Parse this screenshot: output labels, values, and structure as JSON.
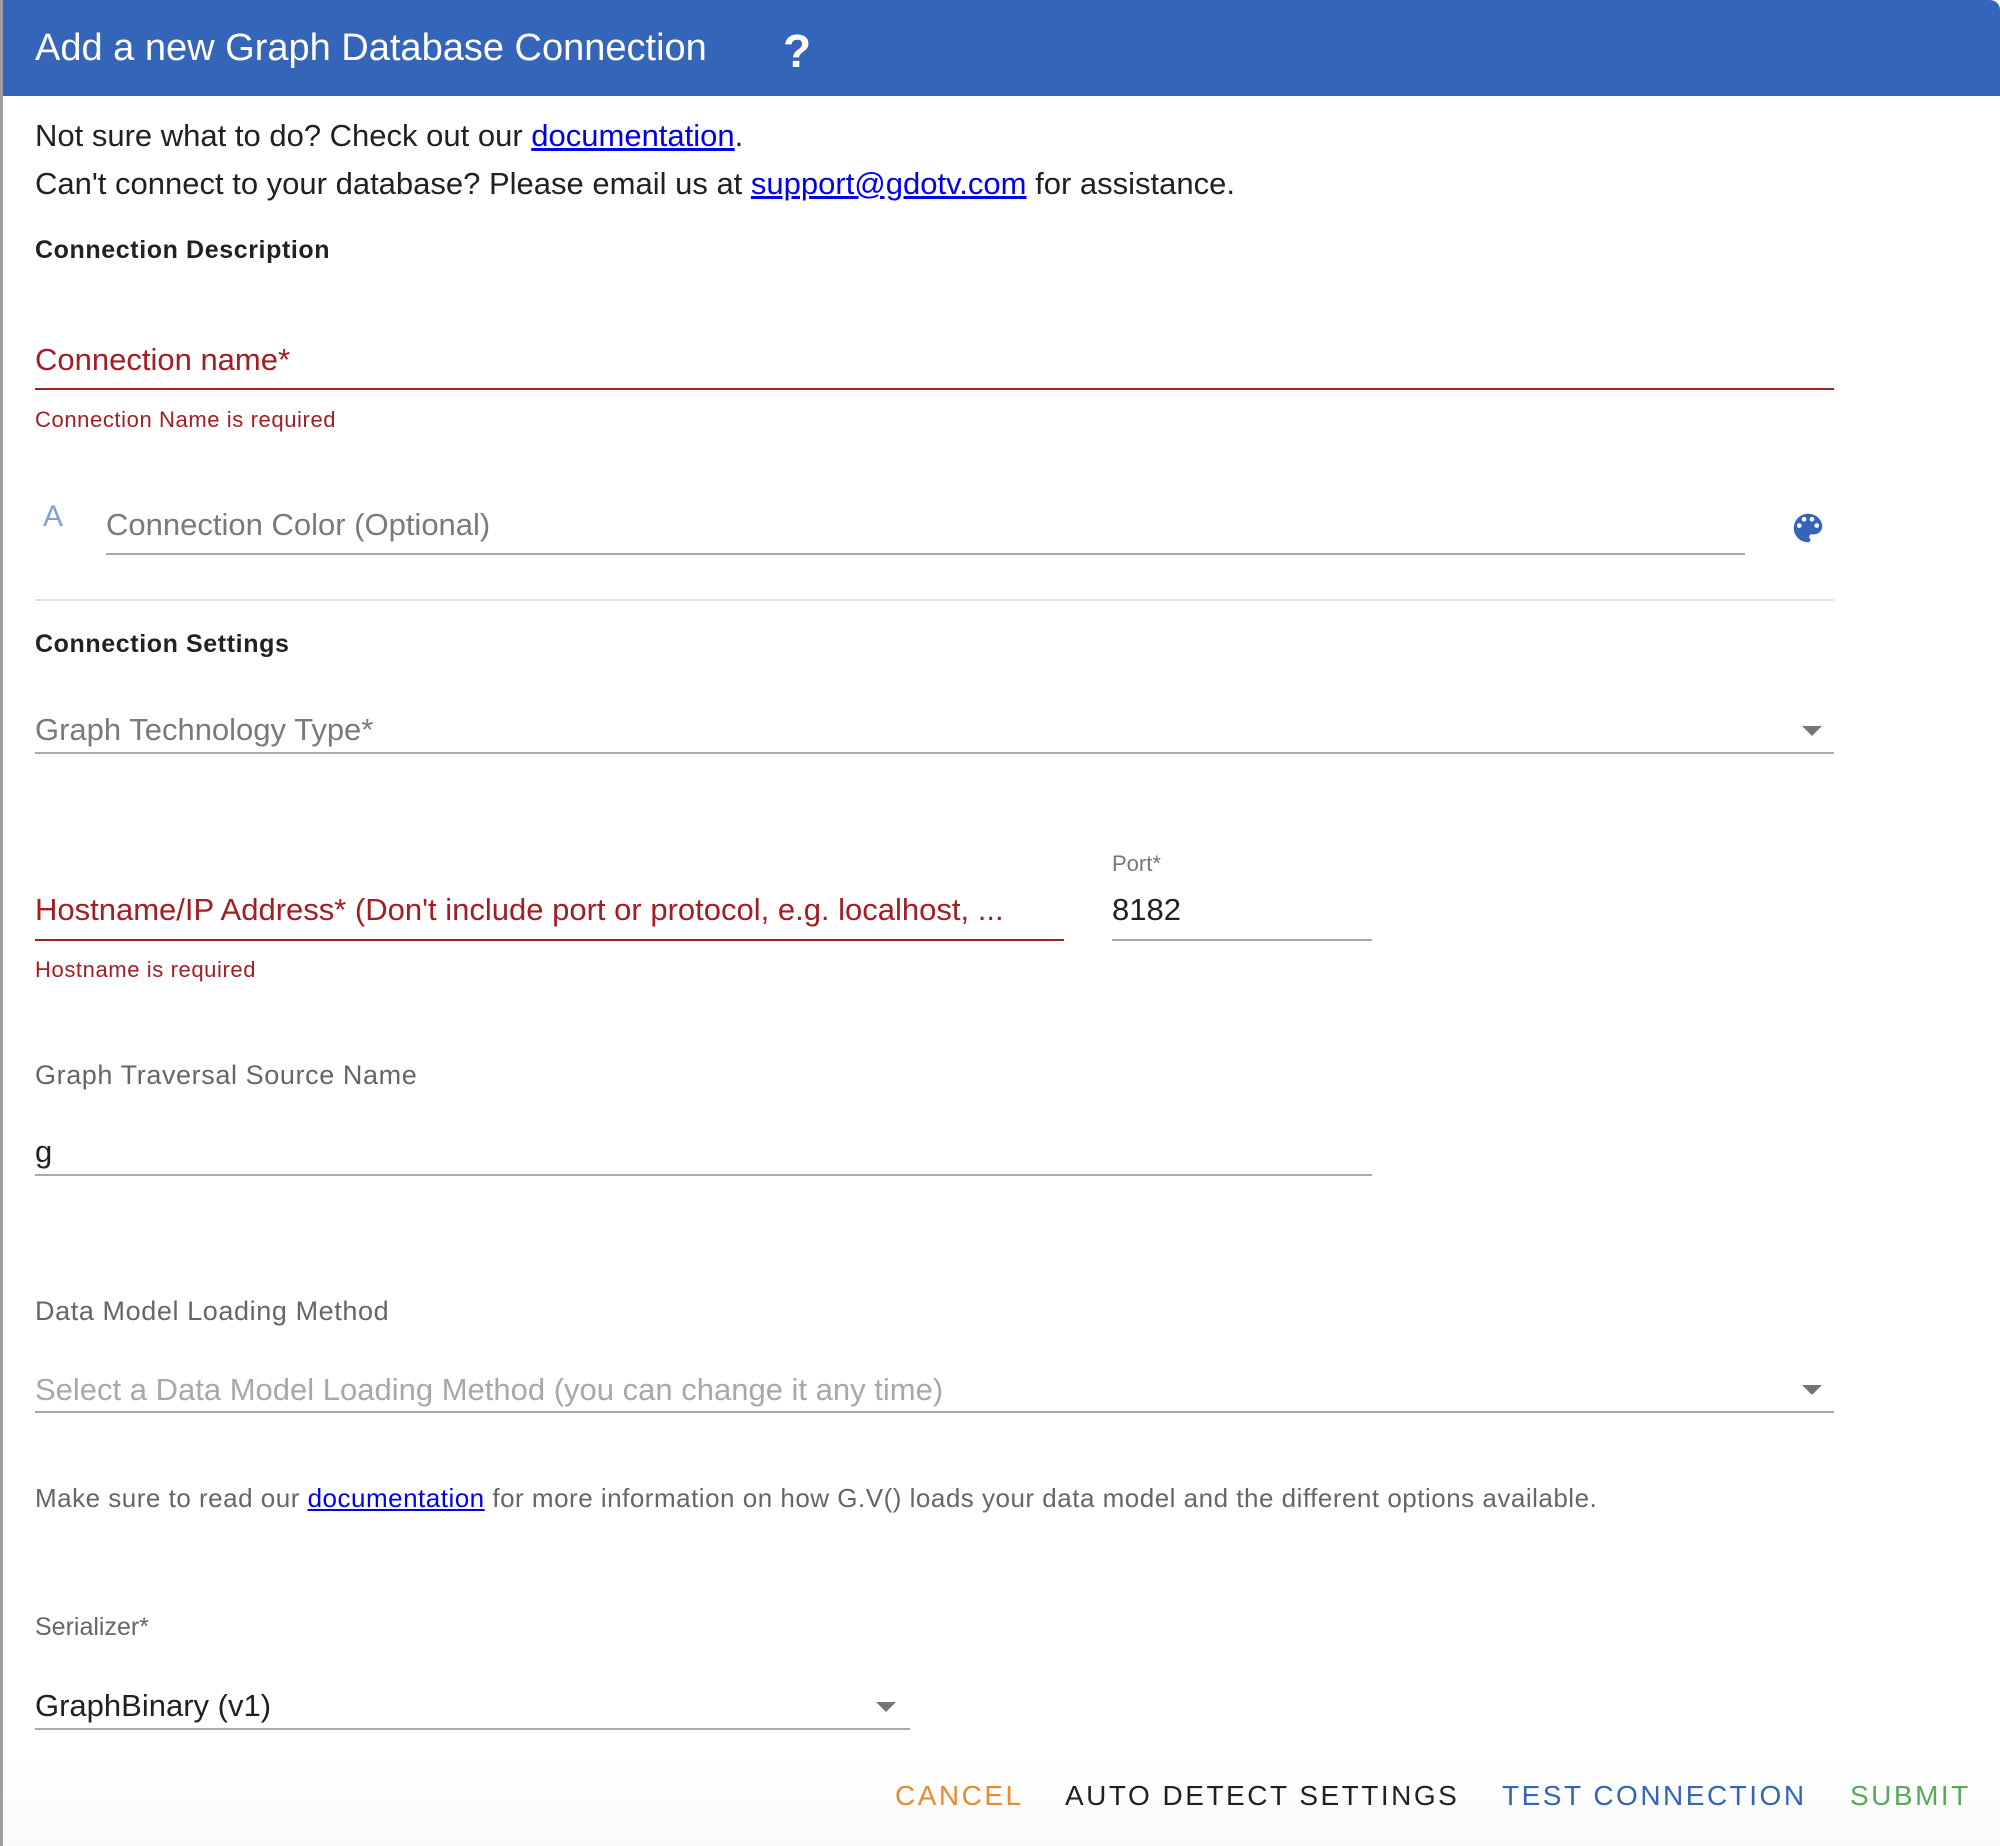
{
  "dialog": {
    "title": "Add a new Graph Database Connection",
    "help_icon": "question-mark-icon"
  },
  "intro": {
    "line1_prefix": "Not sure what to do? Check out our ",
    "line1_link": "documentation",
    "line1_suffix": ".",
    "line2_prefix": "Can't connect to your database? Please email us at ",
    "line2_link": "support@gdotv.com",
    "line2_suffix": " for assistance."
  },
  "connection_description": {
    "title": "Connection Description",
    "name_field": {
      "label": "Connection name*",
      "value": "",
      "error": "Connection Name is required"
    },
    "color_field": {
      "prefix_icon_text": "A",
      "placeholder": "Connection Color (Optional)",
      "value": "",
      "picker_icon": "palette-icon"
    }
  },
  "connection_settings": {
    "title": "Connection Settings",
    "technology_select": {
      "label": "Graph Technology Type*",
      "value": ""
    },
    "hostname_field": {
      "label": "Hostname/IP Address* (Don't include port or protocol, e.g. localhost, ...",
      "value": "",
      "error": "Hostname is required"
    },
    "port_field": {
      "label": "Port*",
      "value": "8182"
    },
    "traversal_source": {
      "label": "Graph Traversal Source Name",
      "value": "g"
    },
    "data_model": {
      "label": "Data Model Loading Method",
      "placeholder": "Select a Data Model Loading Method (you can change it any time)",
      "value": ""
    },
    "helper": {
      "prefix": "Make sure to read our ",
      "link": "documentation",
      "suffix": " for more information on how G.V() loads your data model and the different options available."
    },
    "serializer": {
      "label": "Serializer*",
      "value": "GraphBinary (v1)"
    }
  },
  "actions": {
    "cancel": "CANCEL",
    "auto_detect": "AUTO DETECT SETTINGS",
    "test_connection": "TEST CONNECTION",
    "submit": "SUBMIT"
  },
  "colors": {
    "header": "#3465B8",
    "error": "#A31D24",
    "link": "#0000EE",
    "cancel": "#E98A2B",
    "test": "#3465B8",
    "submit": "#5BA85B"
  }
}
